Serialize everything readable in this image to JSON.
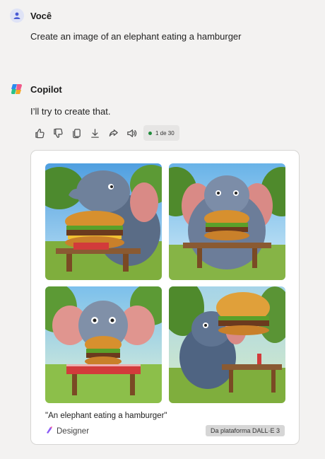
{
  "user": {
    "name": "Você",
    "message": "Create an image of an elephant eating a hamburger"
  },
  "bot": {
    "name": "Copilot",
    "message": "I’ll try to create that.",
    "actions": [
      "thumbs-up-icon",
      "thumbs-down-icon",
      "copy-icon",
      "download-icon",
      "share-icon",
      "speaker-icon"
    ],
    "pager": "1 de 30"
  },
  "image_card": {
    "images": [
      {
        "description": "elephant eating burger at picnic table, sunny park"
      },
      {
        "description": "elephant hugging burger at picnic table"
      },
      {
        "description": "elephant with large burger, checkered tablecloth"
      },
      {
        "description": "elephant holding big burger, park trees"
      }
    ],
    "caption": "\"An elephant eating a hamburger\"",
    "source_label": "Designer",
    "badge": "Da plataforma DALL·E 3"
  },
  "colors": {
    "background": "#f3f2f1",
    "card": "#ffffff",
    "pager_dot": "#1f8b3a"
  }
}
